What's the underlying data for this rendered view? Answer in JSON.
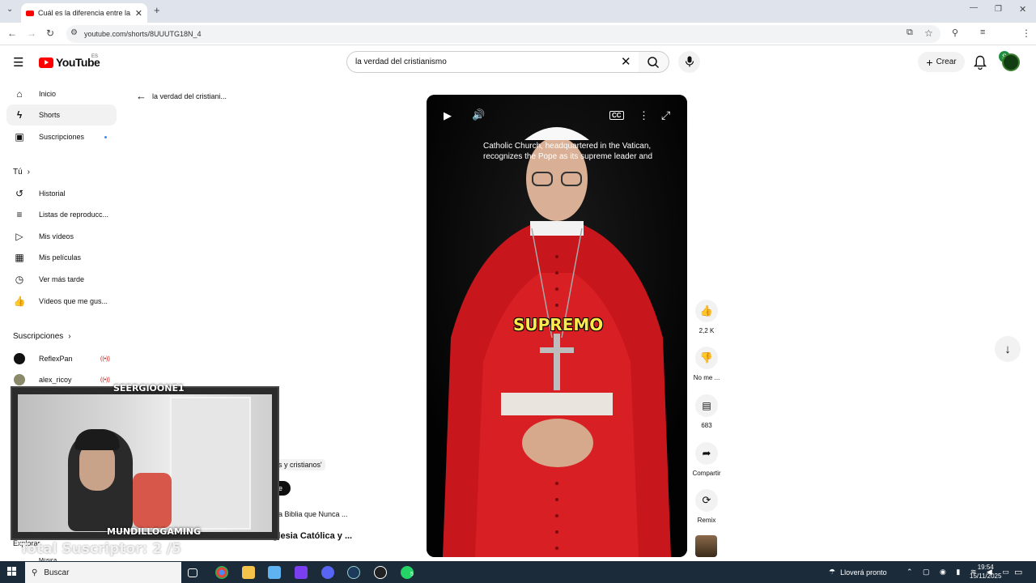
{
  "browser": {
    "tab_title": "Cuál es la diferencia entre la Ig",
    "url": "youtube.com/shorts/8UUUTG18N_4"
  },
  "header": {
    "logo_text": "YouTube",
    "country": "ES",
    "search_value": "la verdad del cristianismo",
    "create_label": "Crear",
    "profile_initial": "S"
  },
  "sidebar": {
    "main": [
      {
        "label": "Inicio",
        "icon": "home-icon"
      },
      {
        "label": "Shorts",
        "icon": "shorts-icon"
      },
      {
        "label": "Suscripciones",
        "icon": "subscriptions-icon"
      }
    ],
    "you_heading": "Tú",
    "you_items": [
      {
        "label": "Historial",
        "icon": "history-icon"
      },
      {
        "label": "Listas de reproducc...",
        "icon": "playlists-icon"
      },
      {
        "label": "Mis vídeos",
        "icon": "my-videos-icon"
      },
      {
        "label": "Mis películas",
        "icon": "movies-icon"
      },
      {
        "label": "Ver más tarde",
        "icon": "watch-later-icon"
      },
      {
        "label": "Vídeos que me gus...",
        "icon": "liked-icon"
      }
    ],
    "subs_heading": "Suscripciones",
    "channels": [
      {
        "label": "ReflexPan",
        "live": "((•))"
      },
      {
        "label": "alex_ricoy",
        "live": "((•))"
      }
    ],
    "explore_label": "Explorar",
    "music_label": "Música"
  },
  "search_context": {
    "back_label": "la verdad del cristiani..."
  },
  "video": {
    "caption": "Catholic Church, headquartered in the Vatican, recognizes the Pope as its supreme leader and",
    "subtitle": "SUPREMO"
  },
  "actions": {
    "like_count": "2,2 K",
    "dislike_label": "No me ...",
    "comment_count": "683",
    "share_label": "Compartir",
    "remix_label": "Remix"
  },
  "background_text": {
    "quote": "s y cristianos'",
    "chip": "e",
    "related_1": "a Biblia que Nunca ...",
    "related_2": "Cuál es la diferencia entre la Iglesia Católica y ..."
  },
  "overlay": {
    "top_name": "SEERGIOONE1",
    "bottom_name": "MUNDILLOGAMING",
    "subs_counter": "Total Suscriptor: 2 /5"
  },
  "taskbar": {
    "search_label": "Buscar",
    "weather": "Lloverá pronto",
    "time": "19:54",
    "date": "15/11/2025",
    "whatsapp_badge": "5"
  }
}
